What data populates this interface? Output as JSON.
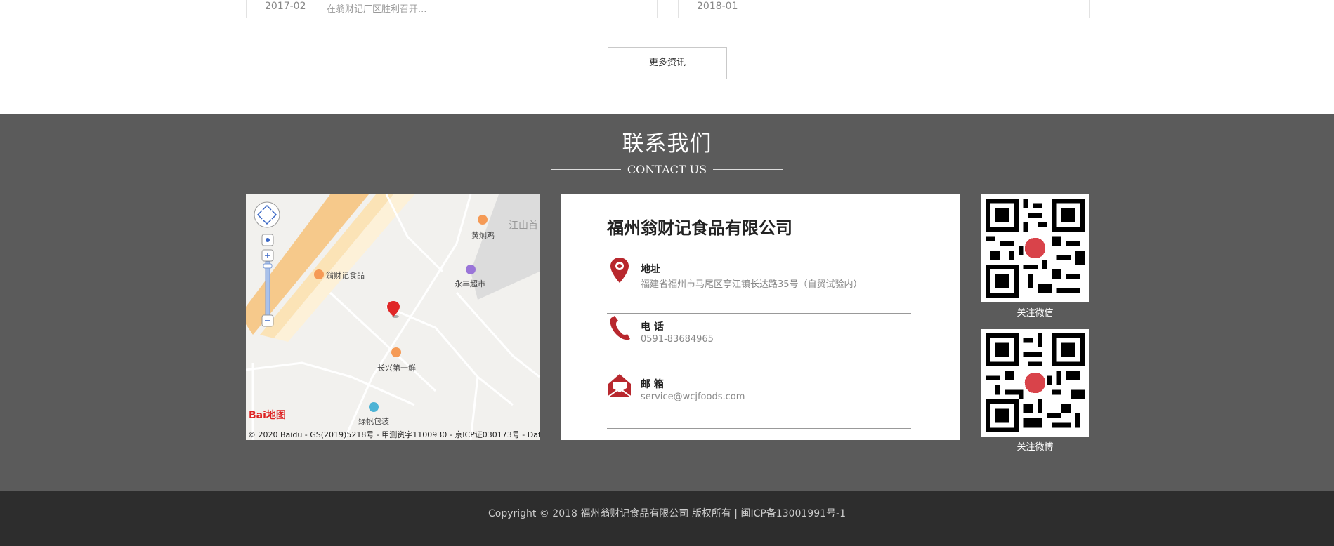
{
  "news": {
    "left": {
      "date": "2017-02",
      "text": "在翁财记厂区胜利召开..."
    },
    "right": {
      "date": "2018-01"
    }
  },
  "more_button": "更多资讯",
  "contact": {
    "title": "联系我们",
    "subtitle": "CONTACT US",
    "company": "福州翁财记食品有限公司",
    "rows": [
      {
        "label": "地址",
        "value": "福建省福州市马尾区亭江镇长达路35号（自贸试验内）",
        "icon": "location-pin-icon"
      },
      {
        "label": "电 话",
        "value": "0591-83684965",
        "icon": "phone-icon"
      },
      {
        "label": "邮 箱",
        "value": "service@wcjfoods.com",
        "icon": "mail-icon"
      }
    ],
    "qr": [
      {
        "caption": "关注微信"
      },
      {
        "caption": "关注微博"
      }
    ]
  },
  "map": {
    "pois": [
      "黄焖鸡",
      "江山首",
      "翁财记食品",
      "永丰超市",
      "长兴第一鲜",
      "绿帆包装"
    ],
    "logo": "Bai地图",
    "copyright": "© 2020 Baidu - GS(2019)5218号 - 甲测资字1100930 - 京ICP证030173号 - Dat"
  },
  "footer": {
    "text": "Copyright © 2018  福州翁财记食品有限公司  版权所有 |  闽ICP备13001991号-1"
  },
  "colors": {
    "accent": "#b8282e",
    "section_bg": "#5b5b5b",
    "footer_bg": "#2d2d2d"
  }
}
